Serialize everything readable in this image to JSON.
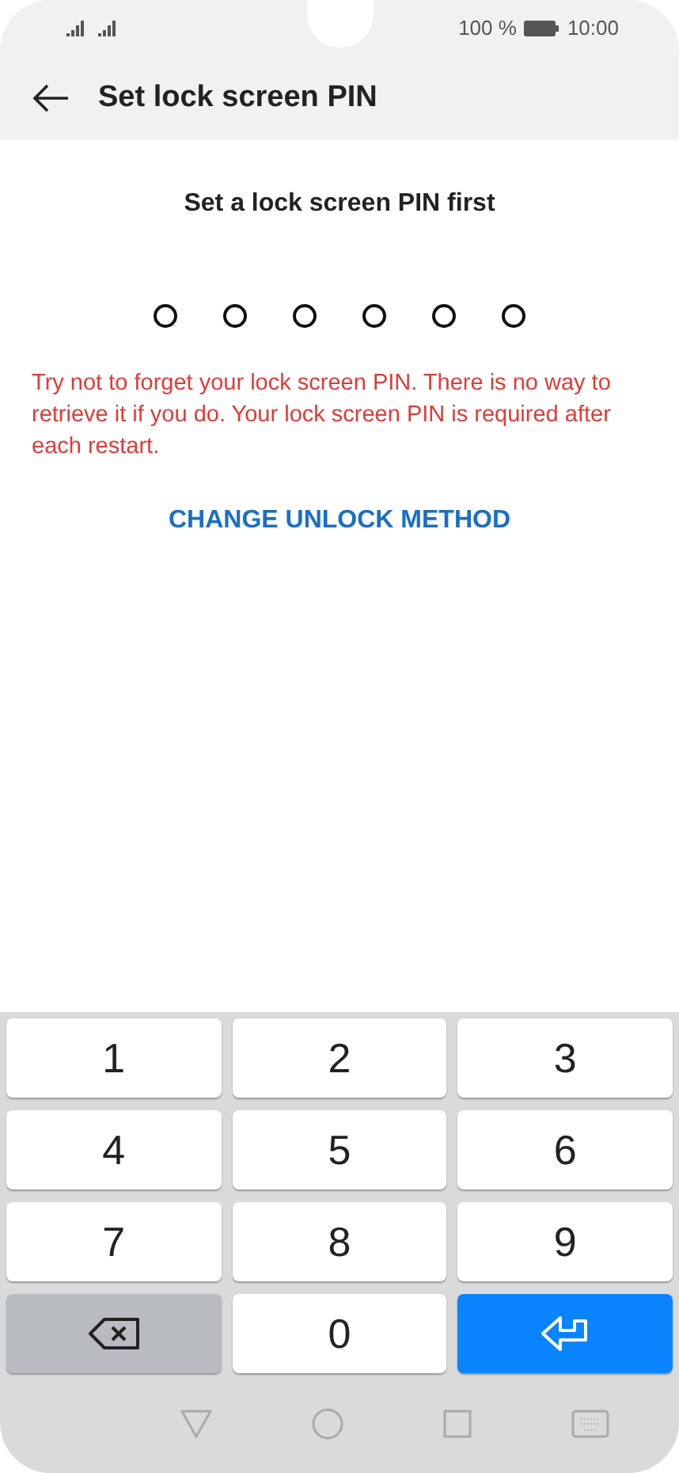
{
  "status_bar": {
    "battery_percent": "100 %",
    "time": "10:00"
  },
  "header": {
    "title": "Set lock screen PIN"
  },
  "prompt": "Set a lock screen PIN first",
  "pin_dots": [
    {
      "filled": false
    },
    {
      "filled": false
    },
    {
      "filled": false
    },
    {
      "filled": false
    },
    {
      "filled": false
    },
    {
      "filled": false
    }
  ],
  "warning": "Try not to forget your lock screen PIN. There is no way to retrieve it if you do. Your lock screen PIN is required after each restart.",
  "change_method_link": "CHANGE UNLOCK METHOD",
  "keypad": [
    {
      "kind": "digit",
      "label": "1"
    },
    {
      "kind": "digit",
      "label": "2"
    },
    {
      "kind": "digit",
      "label": "3"
    },
    {
      "kind": "digit",
      "label": "4"
    },
    {
      "kind": "digit",
      "label": "5"
    },
    {
      "kind": "digit",
      "label": "6"
    },
    {
      "kind": "digit",
      "label": "7"
    },
    {
      "kind": "digit",
      "label": "8"
    },
    {
      "kind": "digit",
      "label": "9"
    },
    {
      "kind": "backspace"
    },
    {
      "kind": "digit",
      "label": "0"
    },
    {
      "kind": "enter"
    }
  ]
}
